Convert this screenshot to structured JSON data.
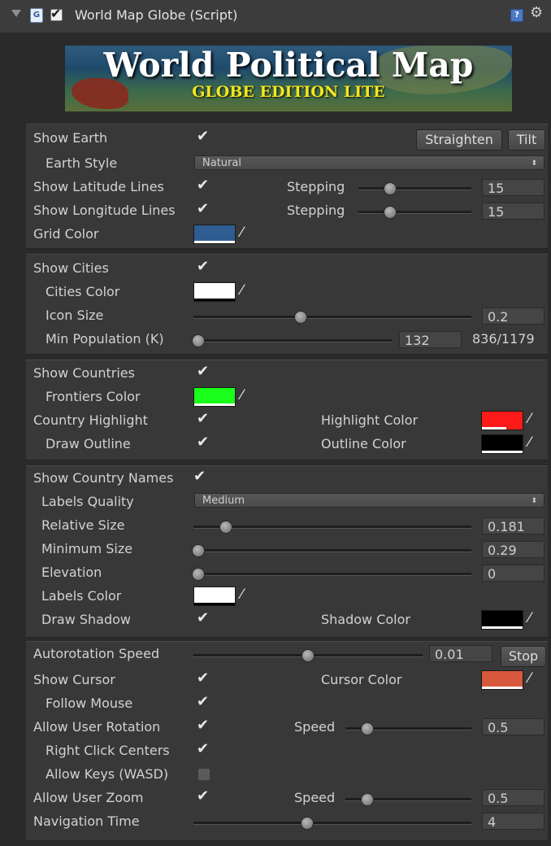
{
  "header": {
    "component_title": "World Map Globe (Script)",
    "script_icon_glyph": "G",
    "help_icon_glyph": "?",
    "gear_icon_glyph": "⚙"
  },
  "banner": {
    "title": "World Political Map",
    "subtitle": "GLOBE EDITION LITE"
  },
  "earth": {
    "show_earth_label": "Show Earth",
    "straighten_label": "Straighten",
    "tilt_label": "Tilt",
    "earth_style_label": "Earth Style",
    "earth_style_value": "Natural",
    "lat_label": "Show Latitude Lines",
    "lat_stepping_label": "Stepping",
    "lat_stepping_value": "15",
    "lon_label": "Show Longitude Lines",
    "lon_stepping_label": "Stepping",
    "lon_stepping_value": "15",
    "grid_color_label": "Grid Color",
    "grid_color": "#2f5d91"
  },
  "cities": {
    "show_cities_label": "Show Cities",
    "cities_color_label": "Cities Color",
    "cities_color": "#ffffff",
    "icon_size_label": "Icon Size",
    "icon_size_value": "0.2",
    "min_pop_label": "Min Population (K)",
    "min_pop_value": "132",
    "city_count": "836/1179"
  },
  "countries": {
    "show_countries_label": "Show Countries",
    "frontiers_color_label": "Frontiers Color",
    "frontiers_color": "#19ff19",
    "country_highlight_label": "Country Highlight",
    "highlight_color_label": "Highlight Color",
    "highlight_color": "#ff1a1a",
    "draw_outline_label": "Draw Outline",
    "outline_color_label": "Outline Color",
    "outline_color": "#000000"
  },
  "names": {
    "show_names_label": "Show Country Names",
    "labels_quality_label": "Labels Quality",
    "labels_quality_value": "Medium",
    "relative_size_label": "Relative Size",
    "relative_size_value": "0.181",
    "minimum_size_label": "Minimum Size",
    "minimum_size_value": "0.29",
    "elevation_label": "Elevation",
    "elevation_value": "0",
    "labels_color_label": "Labels Color",
    "labels_color": "#ffffff",
    "draw_shadow_label": "Draw Shadow",
    "shadow_color_label": "Shadow Color",
    "shadow_color": "#000000"
  },
  "navigation": {
    "autorotation_label": "Autorotation Speed",
    "autorotation_value": "0.01",
    "stop_label": "Stop",
    "show_cursor_label": "Show Cursor",
    "cursor_color_label": "Cursor Color",
    "cursor_color": "#d7583c",
    "follow_mouse_label": "Follow Mouse",
    "allow_rotation_label": "Allow User Rotation",
    "rotation_speed_label": "Speed",
    "rotation_speed_value": "0.5",
    "right_click_label": "Right Click Centers",
    "allow_keys_label": "Allow Keys (WASD)",
    "allow_zoom_label": "Allow User Zoom",
    "zoom_speed_label": "Speed",
    "zoom_speed_value": "0.5",
    "nav_time_label": "Navigation Time",
    "nav_time_value": "4"
  },
  "checkbox_glyph": "✔",
  "dropdown_arrow_glyph": "⬍",
  "eyedropper_glyph": "⁄"
}
